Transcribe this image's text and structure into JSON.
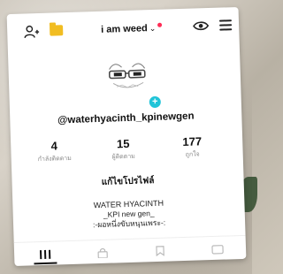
{
  "header": {
    "username": "i am weed",
    "chevron": "⌄",
    "icons": [
      "add-user-icon",
      "folder-icon",
      "eye-icon",
      "menu-icon"
    ],
    "notification_color": "#ff2c55",
    "folder_color": "#f1bd22"
  },
  "profile": {
    "handle": "@waterhyacinth_kpinewgen",
    "add_badge": "+",
    "badge_color": "#20c4d8"
  },
  "stats": [
    {
      "value": "4",
      "label": "กำลังติดตาม"
    },
    {
      "value": "15",
      "label": "ผู้ติดตาม"
    },
    {
      "value": "177",
      "label": "ถูกใจ"
    }
  ],
  "edit_profile_label": "แก้ไขโปรไฟล์",
  "bio": {
    "line1": "WATER HYACINTH",
    "line2": "_KPI new gen_",
    "line3": ":-ผอหนึ่งขับหนุนเพระ-:"
  },
  "tabs": [
    {
      "name": "grid-icon",
      "active": true
    },
    {
      "name": "lock-icon",
      "active": false
    },
    {
      "name": "bookmark-icon",
      "active": false
    },
    {
      "name": "heart-icon",
      "active": false
    }
  ]
}
